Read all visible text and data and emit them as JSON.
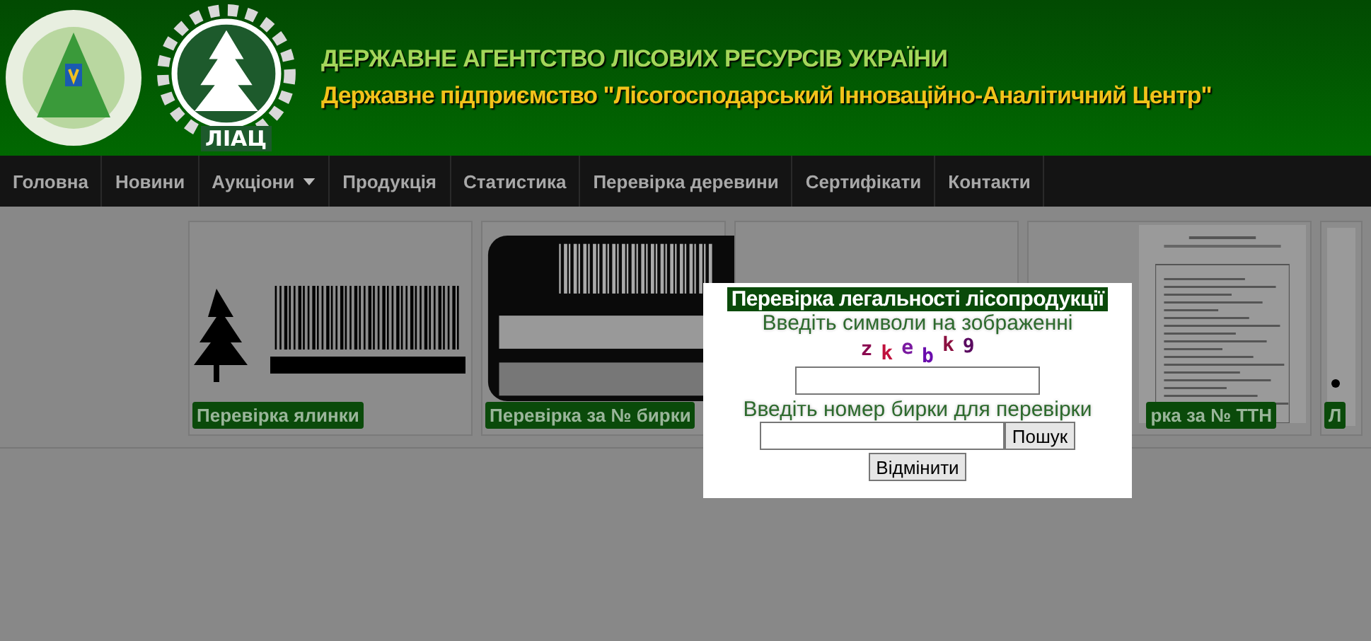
{
  "header": {
    "agency": "ДЕРЖАВНЕ АГЕНТСТВО ЛІСОВИХ РЕСУРСІВ УКРАЇНИ",
    "company": "Державне підприємство \"Лісогосподарський Інноваційно-Аналітичний Центр\"",
    "logo_text": "ЛІАЦ"
  },
  "nav": [
    {
      "label": "Головна",
      "dropdown": false
    },
    {
      "label": "Новини",
      "dropdown": false
    },
    {
      "label": "Аукціони",
      "dropdown": true
    },
    {
      "label": "Продукція",
      "dropdown": false
    },
    {
      "label": "Статистика",
      "dropdown": false
    },
    {
      "label": "Перевірка деревини",
      "dropdown": false
    },
    {
      "label": "Сертифікати",
      "dropdown": false
    },
    {
      "label": "Контакти",
      "dropdown": false
    }
  ],
  "cards": [
    {
      "kind": "tree",
      "label": "Перевірка ялинки"
    },
    {
      "kind": "tag",
      "label": "Перевірка за № бирки"
    },
    {
      "kind": "blank"
    },
    {
      "kind": "document",
      "label": "рка за № ТТН"
    },
    {
      "kind": "partial",
      "label": "Л"
    }
  ],
  "dialog": {
    "title": "Перевірка легальності лісопродукції",
    "captcha_prompt": "Введіть символи на зображенні",
    "captcha": [
      {
        "char": "z",
        "color": "#8b0a50"
      },
      {
        "char": "k",
        "color": "#c0103c"
      },
      {
        "char": "e",
        "color": "#7a1aa0"
      },
      {
        "char": "b",
        "color": "#6a0dad"
      },
      {
        "char": "k",
        "color": "#8b1040"
      },
      {
        "char": "9",
        "color": "#5a0a60"
      }
    ],
    "tag_prompt": "Введіть номер бирки для перевірки",
    "search_button": "Пошук",
    "cancel_button": "Відмінити"
  }
}
